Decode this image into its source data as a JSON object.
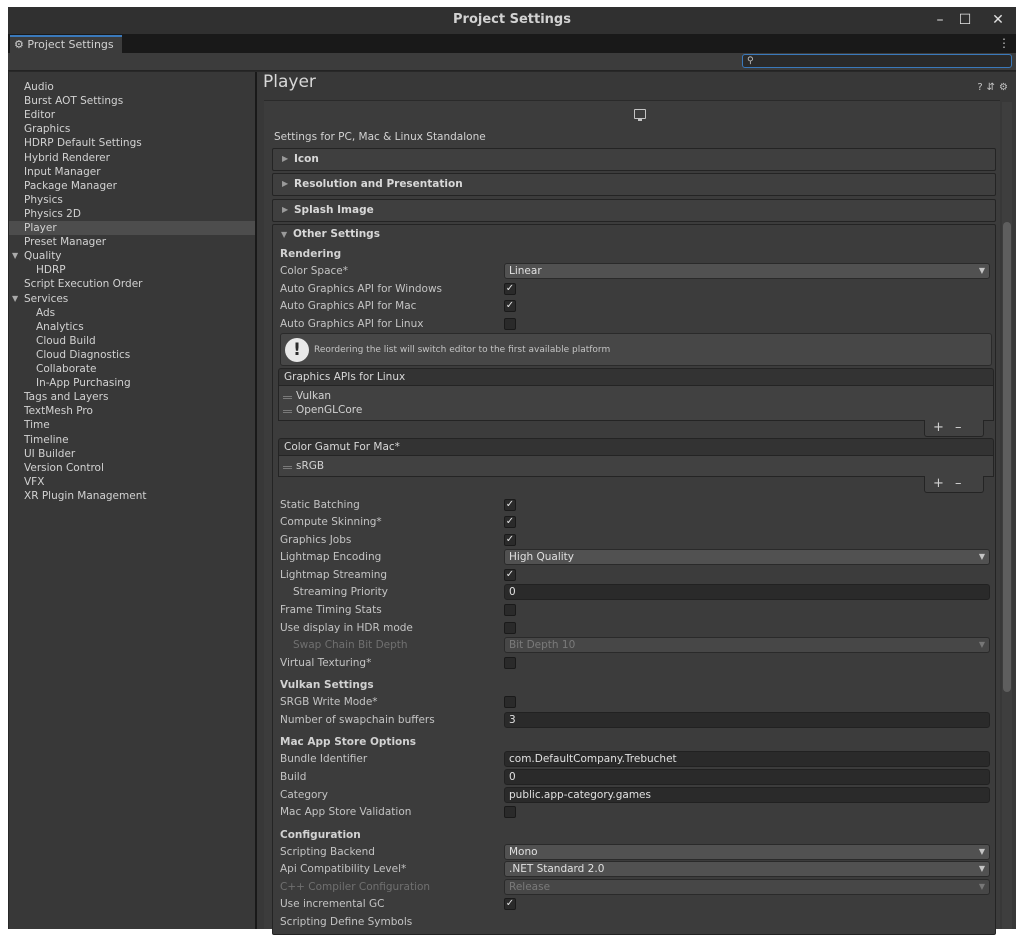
{
  "window": {
    "title": "Project Settings",
    "controls": [
      "minimize",
      "maximize",
      "close"
    ]
  },
  "tab": {
    "label": "Project Settings",
    "icon": "gear-icon"
  },
  "search": {
    "placeholder": ""
  },
  "sidebar": {
    "items": [
      {
        "label": "Audio",
        "indent": 0
      },
      {
        "label": "Burst AOT Settings",
        "indent": 0
      },
      {
        "label": "Editor",
        "indent": 0
      },
      {
        "label": "Graphics",
        "indent": 0
      },
      {
        "label": "HDRP Default Settings",
        "indent": 0
      },
      {
        "label": "Hybrid Renderer",
        "indent": 0
      },
      {
        "label": "Input Manager",
        "indent": 0
      },
      {
        "label": "Package Manager",
        "indent": 0
      },
      {
        "label": "Physics",
        "indent": 0
      },
      {
        "label": "Physics 2D",
        "indent": 0
      },
      {
        "label": "Player",
        "indent": 0,
        "selected": true
      },
      {
        "label": "Preset Manager",
        "indent": 0
      },
      {
        "label": "Quality",
        "indent": 0,
        "expanded": true
      },
      {
        "label": "HDRP",
        "indent": 1
      },
      {
        "label": "Script Execution Order",
        "indent": 0
      },
      {
        "label": "Services",
        "indent": 0,
        "expanded": true
      },
      {
        "label": "Ads",
        "indent": 1
      },
      {
        "label": "Analytics",
        "indent": 1
      },
      {
        "label": "Cloud Build",
        "indent": 1
      },
      {
        "label": "Cloud Diagnostics",
        "indent": 1
      },
      {
        "label": "Collaborate",
        "indent": 1
      },
      {
        "label": "In-App Purchasing",
        "indent": 1
      },
      {
        "label": "Tags and Layers",
        "indent": 0
      },
      {
        "label": "TextMesh Pro",
        "indent": 0
      },
      {
        "label": "Time",
        "indent": 0
      },
      {
        "label": "Timeline",
        "indent": 0
      },
      {
        "label": "UI Builder",
        "indent": 0
      },
      {
        "label": "Version Control",
        "indent": 0
      },
      {
        "label": "VFX",
        "indent": 0
      },
      {
        "label": "XR Plugin Management",
        "indent": 0
      }
    ]
  },
  "main": {
    "title": "Player",
    "header_icons": [
      "help-icon",
      "preset-icon",
      "settings-icon"
    ],
    "platform_icon": "monitor-icon",
    "platform_label": "Settings for PC, Mac & Linux Standalone",
    "sections": {
      "icon": "Icon",
      "resolution": "Resolution and Presentation",
      "splash": "Splash Image",
      "other": "Other Settings"
    },
    "groups": {
      "rendering": "Rendering",
      "vulkan": "Vulkan Settings",
      "mac_store": "Mac App Store Options",
      "configuration": "Configuration"
    },
    "fields": {
      "color_space": {
        "label": "Color Space*",
        "value": "Linear"
      },
      "auto_api_windows": {
        "label": "Auto Graphics API  for Windows",
        "checked": true
      },
      "auto_api_mac": {
        "label": "Auto Graphics API  for Mac",
        "checked": true
      },
      "auto_api_linux": {
        "label": "Auto Graphics API  for Linux",
        "checked": false
      },
      "help_message": "Reordering the list will switch editor to the first available platform",
      "linux_apis": {
        "header": "Graphics APIs for Linux",
        "items": [
          "Vulkan",
          "OpenGLCore"
        ]
      },
      "color_gamut": {
        "header": "Color Gamut For Mac*",
        "items": [
          "sRGB"
        ]
      },
      "static_batching": {
        "label": "Static Batching",
        "checked": true
      },
      "compute_skinning": {
        "label": "Compute Skinning*",
        "checked": true
      },
      "graphics_jobs": {
        "label": "Graphics Jobs",
        "checked": true
      },
      "lightmap_encoding": {
        "label": "Lightmap Encoding",
        "value": "High Quality"
      },
      "lightmap_streaming": {
        "label": "Lightmap Streaming",
        "checked": true
      },
      "streaming_priority": {
        "label": "Streaming Priority",
        "value": "0"
      },
      "frame_timing": {
        "label": "Frame Timing Stats",
        "checked": false
      },
      "hdr_display": {
        "label": "Use display in HDR mode",
        "checked": false
      },
      "swap_chain_depth": {
        "label": "Swap Chain Bit Depth",
        "value": "Bit Depth 10"
      },
      "virtual_texturing": {
        "label": "Virtual Texturing*",
        "checked": false
      },
      "srgb_write": {
        "label": "SRGB Write Mode*",
        "checked": false
      },
      "swapchain_buffers": {
        "label": "Number of swapchain buffers",
        "value": "3"
      },
      "bundle_id": {
        "label": "Bundle Identifier",
        "value": "com.DefaultCompany.Trebuchet"
      },
      "build": {
        "label": "Build",
        "value": "0"
      },
      "category": {
        "label": "Category",
        "value": "public.app-category.games"
      },
      "mac_validation": {
        "label": "Mac App Store Validation",
        "checked": false
      },
      "scripting_backend": {
        "label": "Scripting Backend",
        "value": "Mono"
      },
      "api_compat": {
        "label": "Api Compatibility Level*",
        "value": ".NET Standard 2.0"
      },
      "cpp_compiler": {
        "label": "C++ Compiler Configuration",
        "value": "Release"
      },
      "incremental_gc": {
        "label": "Use incremental GC",
        "checked": true
      },
      "define_symbols": {
        "label": "Scripting Define Symbols"
      }
    }
  }
}
